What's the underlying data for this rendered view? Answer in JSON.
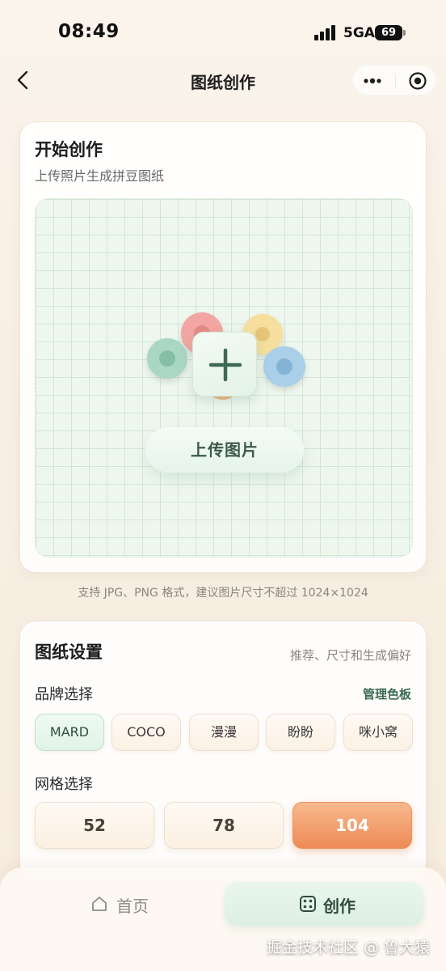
{
  "status_bar": {
    "time": "08:49",
    "network": "5GA",
    "battery": "69"
  },
  "nav": {
    "title": "图纸创作",
    "back_icon": "chevron-left-icon",
    "more_icon": "more-dots-icon",
    "target_icon": "target-icon"
  },
  "upload_card": {
    "title": "开始创作",
    "subtitle": "上传照片生成拼豆图纸",
    "upload_button": "上传图片",
    "bead_colors": [
      "#f2a6a3",
      "#f6df9e",
      "#a9cfe9",
      "#a9d7c3",
      "#f0b27c"
    ]
  },
  "hint": "支持 JPG、PNG 格式，建议图片尺寸不超过 1024×1024",
  "settings": {
    "title": "图纸设置",
    "aside": "推荐、尺寸和生成偏好",
    "brand_label": "品牌选择",
    "manage_link": "管理色板",
    "brands": [
      "MARD",
      "COCO",
      "漫漫",
      "盼盼",
      "咪小窝"
    ],
    "brand_selected": "MARD",
    "grid_label": "网格选择",
    "grid_options": [
      "52",
      "78",
      "104"
    ],
    "grid_selected": "104"
  },
  "tab_bar": {
    "home": {
      "label": "首页",
      "icon": "home-icon"
    },
    "create": {
      "label": "创作",
      "icon": "dice-icon"
    }
  },
  "watermark": "掘金技术社区 @ 鲁大猿",
  "colors": {
    "accent_green": "#3c6b52",
    "accent_orange": "#ee8a55"
  }
}
